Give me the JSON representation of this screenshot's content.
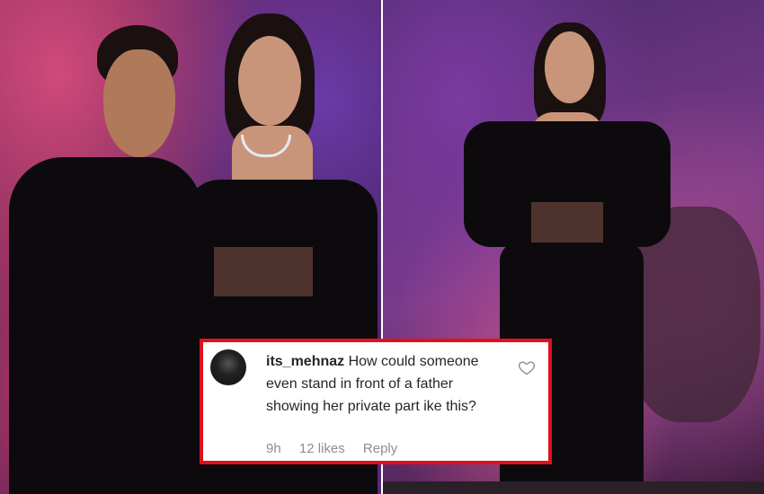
{
  "comment": {
    "username": "its_mehnaz",
    "text": "How could someone even stand in front of a father showing her private part ike this?",
    "time": "9h",
    "likes": "12 likes",
    "reply_label": "Reply",
    "like_icon": "heart-outline-icon"
  },
  "colors": {
    "card_border": "#e0101c",
    "meta_text": "#8e8e8e"
  }
}
